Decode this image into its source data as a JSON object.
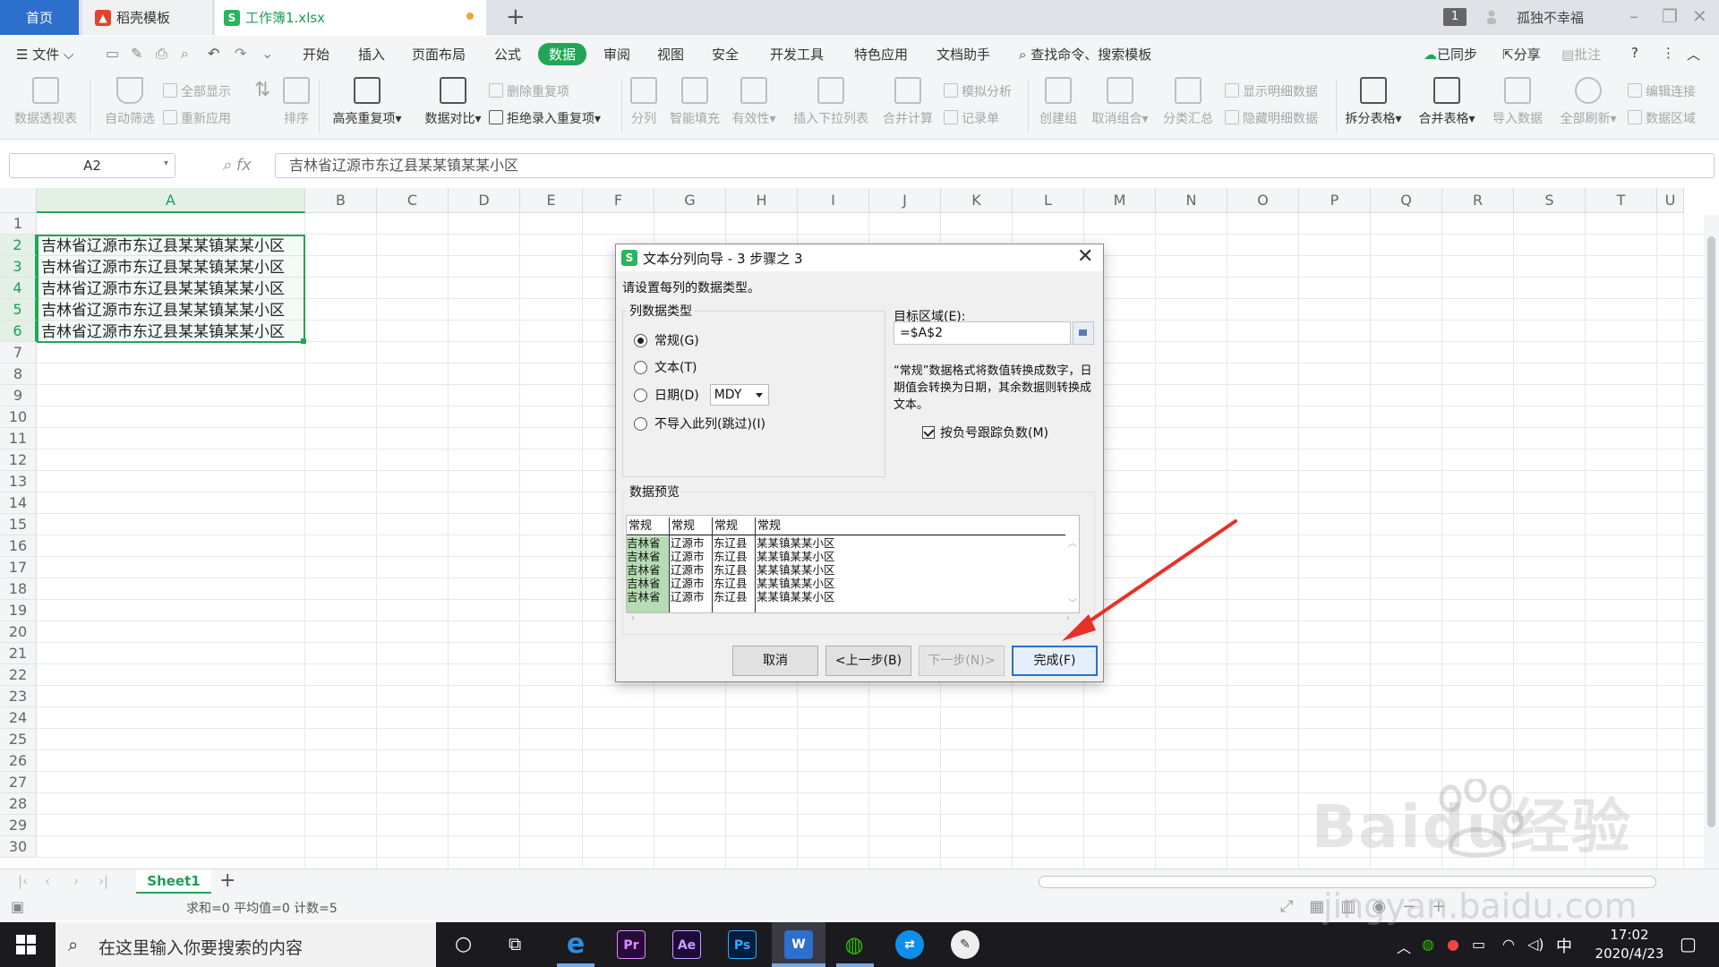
{
  "tabs": {
    "home": "首页",
    "templates": "稻壳模板",
    "book": "工作簿1.xlsx"
  },
  "account": {
    "badge": "1",
    "user": "孤独不幸福"
  },
  "menu": {
    "file": "文件",
    "items": [
      "开始",
      "插入",
      "页面布局",
      "公式",
      "数据",
      "审阅",
      "视图",
      "安全",
      "开发工具",
      "特色应用",
      "文档助手"
    ],
    "active": "数据",
    "search": "查找命令、搜索模板",
    "sync": "已同步",
    "share": "分享",
    "comment": "批注"
  },
  "ribbon": {
    "pivot": "数据透视表",
    "autofilter": "自动筛选",
    "show_all": "全部显示",
    "reapply": "重新应用",
    "sort": "排序",
    "highlight_dup": "高亮重复项",
    "compare": "数据对比",
    "remove_dup": "删除重复项",
    "reject_dup": "拒绝录入重复项",
    "split": "分列",
    "smart_fill": "智能填充",
    "validity": "有效性",
    "insert_dropdown": "插入下拉列表",
    "consolidate": "合并计算",
    "simulate": "模拟分析",
    "record": "记录单",
    "group": "创建组",
    "ungroup": "取消组合",
    "subtotal": "分类汇总",
    "show_detail": "显示明细数据",
    "hide_detail": "隐藏明细数据",
    "split_table": "拆分表格",
    "merge_table": "合并表格",
    "import": "导入数据",
    "refresh_all": "全部刷新",
    "edit_links": "编辑连接",
    "data_region": "数据区域"
  },
  "formula": {
    "namebox": "A2",
    "fx": "fx",
    "content": "吉林省辽源市东辽县某某镇某某小区"
  },
  "columns": [
    "A",
    "B",
    "C",
    "D",
    "E",
    "F",
    "G",
    "H",
    "I",
    "J",
    "K",
    "L",
    "M",
    "N",
    "O",
    "P",
    "Q",
    "R",
    "S",
    "T",
    "U"
  ],
  "rows": [
    "1",
    "2",
    "3",
    "4",
    "5",
    "6",
    "7",
    "8",
    "9",
    "10",
    "11",
    "12",
    "13",
    "14",
    "15",
    "16",
    "17",
    "18",
    "19",
    "20",
    "21",
    "22",
    "23",
    "24",
    "25",
    "26",
    "27",
    "28",
    "29",
    "30"
  ],
  "cells": {
    "a2": "吉林省辽源市东辽县某某镇某某小区",
    "a3": "吉林省辽源市东辽县某某镇某某小区",
    "a4": "吉林省辽源市东辽县某某镇某某小区",
    "a5": "吉林省辽源市东辽县某某镇某某小区",
    "a6": "吉林省辽源市东辽县某某镇某某小区"
  },
  "sheet": {
    "tab": "Sheet1",
    "add": "+"
  },
  "status": {
    "summary": "求和=0  平均值=0  计数=5"
  },
  "dialog": {
    "title": "文本分列向导 - 3 步骤之 3",
    "prompt": "请设置每列的数据类型。",
    "group_type": "列数据类型",
    "opt_general": "常规(G)",
    "opt_text": "文本(T)",
    "opt_date": "日期(D)",
    "date_format": "MDY",
    "opt_skip": "不导入此列(跳过)(I)",
    "selected_option": "常规(G)",
    "dest_label": "目标区域(E):",
    "dest_value": "=$A$2",
    "description": "“常规”数据格式将数值转换成数字，日期值会转换为日期，其余数据则转换成文本。",
    "track_negative": "按负号跟踪负数(M)",
    "track_negative_checked": true,
    "preview_label": "数据预览",
    "preview_headers": [
      "常规",
      "常规",
      "常规",
      "常规"
    ],
    "preview_cols": [
      "吉林省\n吉林省\n吉林省\n吉林省\n吉林省",
      "辽源市\n辽源市\n辽源市\n辽源市\n辽源市",
      "东辽县\n东辽县\n东辽县\n东辽县\n东辽县",
      "某某镇某某小区\n某某镇某某小区\n某某镇某某小区\n某某镇某某小区\n某某镇某某小区"
    ],
    "btn_cancel": "取消",
    "btn_back": "<上一步(B)",
    "btn_next": "下一步(N)>",
    "btn_finish": "完成(F)"
  },
  "taskbar": {
    "search_placeholder": "在这里输入你要搜索的内容",
    "ime": "中",
    "time": "17:02",
    "date": "2020/4/23"
  },
  "watermark": {
    "brand": "Baidu经验",
    "url": "jingyan.baidu.com"
  },
  "colors": {
    "accent_green": "#22a656",
    "tab_blue": "#2d6fcc",
    "arrow_red": "#e8302a",
    "taskbar": "#1a1a1f"
  }
}
